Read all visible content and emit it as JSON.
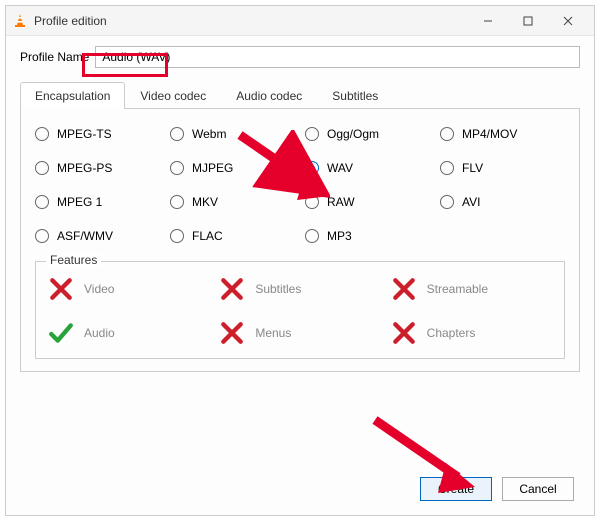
{
  "window": {
    "title": "Profile edition"
  },
  "profile": {
    "label": "Profile Name",
    "value": "Audio (WAV)"
  },
  "tabs": {
    "encapsulation": "Encapsulation",
    "video_codec": "Video codec",
    "audio_codec": "Audio codec",
    "subtitles": "Subtitles"
  },
  "formats": {
    "mpeg_ts": "MPEG-TS",
    "webm": "Webm",
    "ogg": "Ogg/Ogm",
    "mp4_mov": "MP4/MOV",
    "mpeg_ps": "MPEG-PS",
    "mjpeg": "MJPEG",
    "wav": "WAV",
    "flv": "FLV",
    "mpeg_1": "MPEG 1",
    "mkv": "MKV",
    "raw": "RAW",
    "avi": "AVI",
    "asf_wmv": "ASF/WMV",
    "flac": "FLAC",
    "mp3": "MP3"
  },
  "features": {
    "legend": "Features",
    "video": "Video",
    "subtitles": "Subtitles",
    "streamable": "Streamable",
    "audio": "Audio",
    "menus": "Menus",
    "chapters": "Chapters"
  },
  "buttons": {
    "create": "Create",
    "cancel": "Cancel"
  }
}
